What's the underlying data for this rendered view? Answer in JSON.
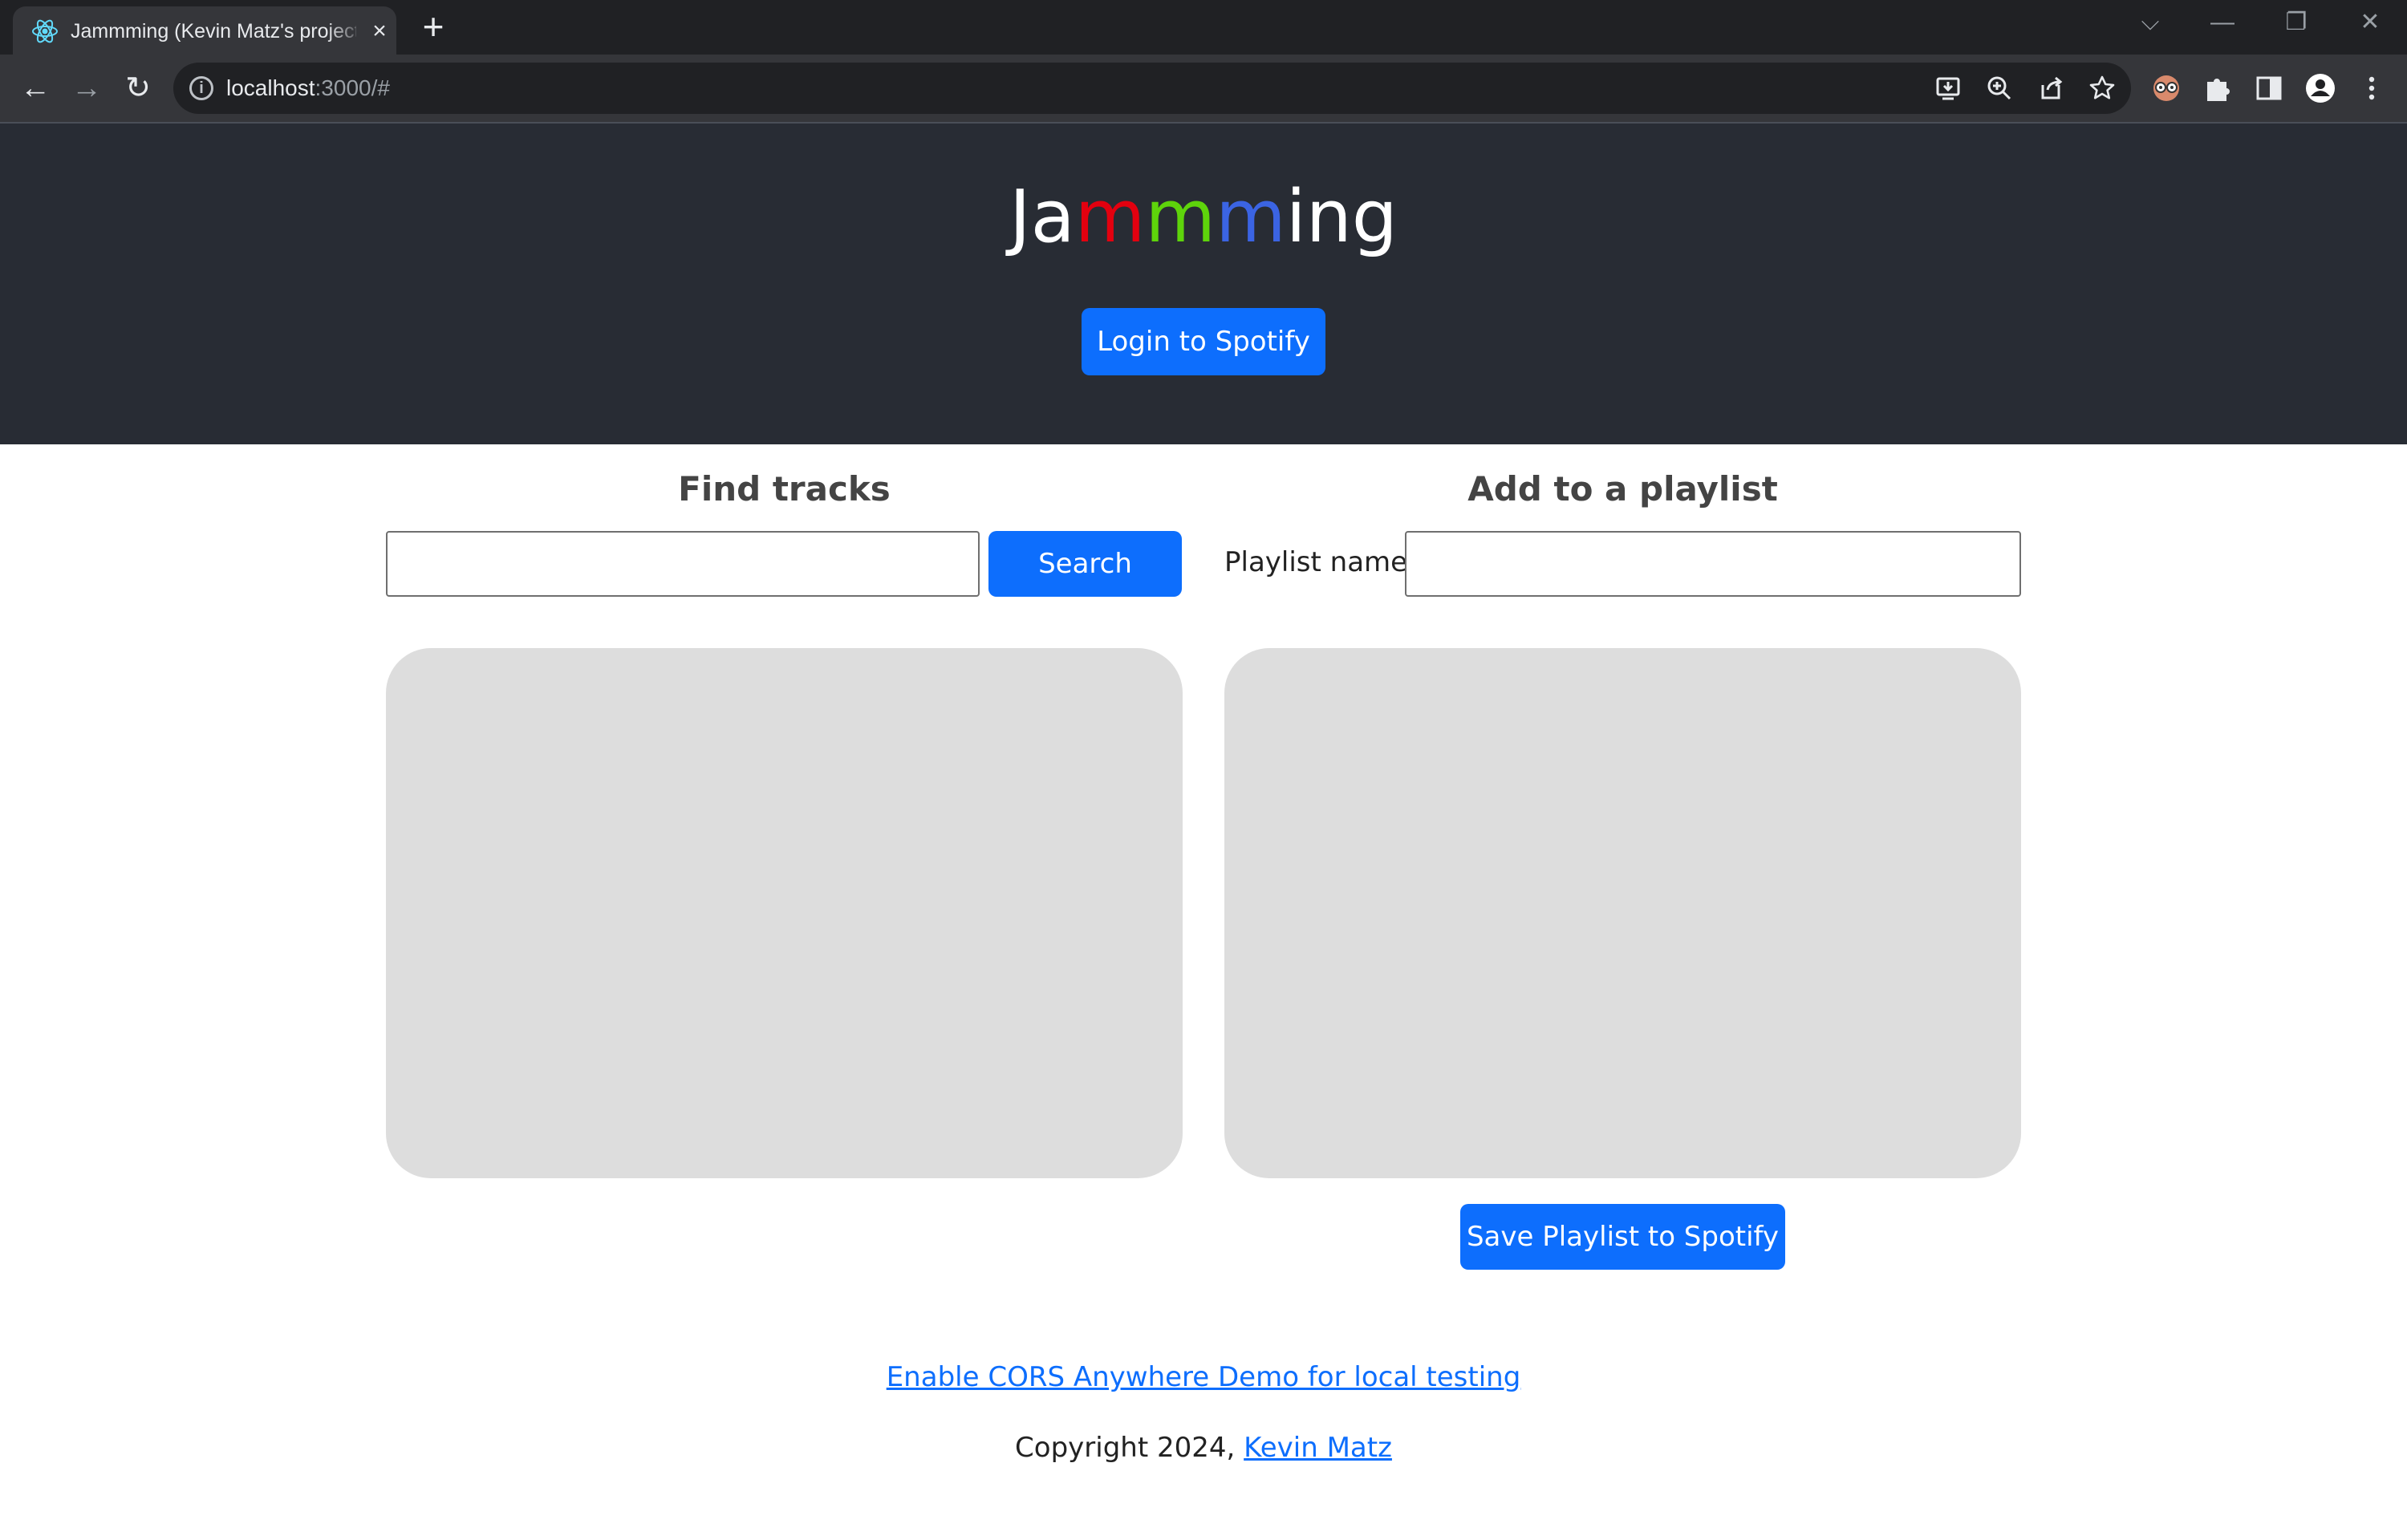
{
  "browser": {
    "tab": {
      "title": "Jammming (Kevin Matz's project",
      "close_icon": "×"
    },
    "new_tab_icon": "+",
    "window_controls": {
      "tab_search_icon": "⌵",
      "minimize_icon": "—",
      "restore_icon": "❐",
      "close_icon": "✕"
    },
    "nav": {
      "back_icon": "←",
      "forward_icon": "→",
      "reload_icon": "↻"
    },
    "address": {
      "info_icon": "i",
      "host": "localhost",
      "rest": ":3000/#"
    },
    "omnibox_icons": [
      "install-icon",
      "zoom-icon",
      "share-icon",
      "bookmark-star-icon"
    ],
    "toolbar_icons": [
      "extension-avatar-icon",
      "extensions-puzzle-icon",
      "side-panel-icon",
      "profile-icon",
      "menu-kebab-icon"
    ]
  },
  "header": {
    "title_parts": {
      "start": "Ja",
      "m1": "m",
      "m2": "m",
      "m3": "m",
      "end": "ing"
    },
    "login_label": "Login to Spotify"
  },
  "search": {
    "heading": "Find tracks",
    "input_value": "",
    "button_label": "Search"
  },
  "playlist": {
    "heading": "Add to a playlist",
    "name_label": "Playlist name",
    "name_value": "",
    "save_label": "Save Playlist to Spotify"
  },
  "footer": {
    "cors_link": "Enable CORS Anywhere Demo for local testing",
    "copyright_text": "Copyright 2024, ",
    "author_link": "Kevin Matz"
  },
  "colors": {
    "header_bg": "#282c34",
    "primary": "#0d6efd",
    "panel_bg": "#dddddd",
    "title_m1": "#e3000f",
    "title_m2": "#5ed40b",
    "title_m3": "#3b64e3"
  }
}
